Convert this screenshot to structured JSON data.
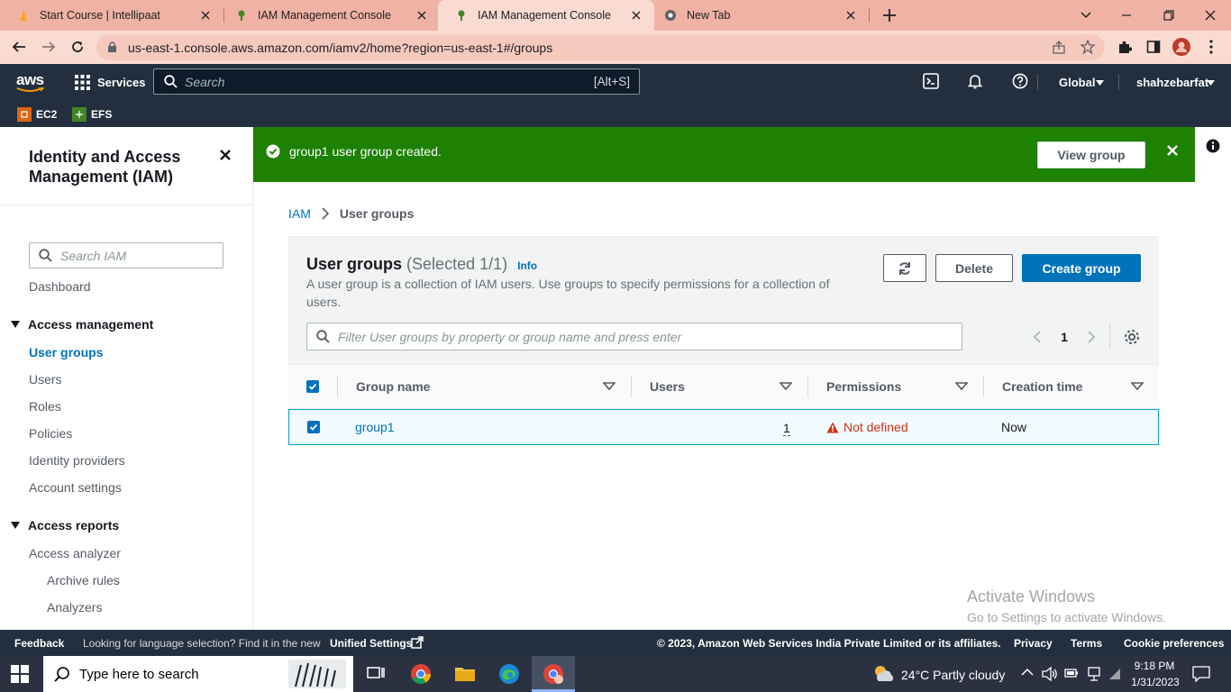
{
  "browser": {
    "tabs": [
      {
        "title": "Start Course | Intellipaat",
        "active": false
      },
      {
        "title": "IAM Management Console",
        "active": false
      },
      {
        "title": "IAM Management Console",
        "active": true
      },
      {
        "title": "New Tab",
        "active": false
      }
    ],
    "url": "us-east-1.console.aws.amazon.com/iamv2/home?region=us-east-1#/groups"
  },
  "aws_header": {
    "logo": "aws",
    "services": "Services",
    "search_placeholder": "Search",
    "search_shortcut": "[Alt+S]",
    "region": "Global",
    "account": "shahzebarfat",
    "favorites": [
      "EC2",
      "EFS"
    ]
  },
  "sidebar": {
    "title": "Identity and Access Management (IAM)",
    "search_placeholder": "Search IAM",
    "dashboard": "Dashboard",
    "section1": "Access management",
    "items1": [
      "User groups",
      "Users",
      "Roles",
      "Policies",
      "Identity providers",
      "Account settings"
    ],
    "active_item": "User groups",
    "section2": "Access reports",
    "items2": [
      "Access analyzer",
      "Archive rules",
      "Analyzers"
    ]
  },
  "flash": {
    "message": "group1 user group created.",
    "button": "View group",
    "color": "#1d8102"
  },
  "breadcrumb": {
    "root": "IAM",
    "current": "User groups"
  },
  "panel": {
    "title": "User groups",
    "count": "(Selected 1/1)",
    "info": "Info",
    "description": "A user group is a collection of IAM users. Use groups to specify permissions for a collection of users.",
    "delete_label": "Delete",
    "create_label": "Create group",
    "filter_placeholder": "Filter User groups by property or group name and press enter",
    "page": "1"
  },
  "table": {
    "columns": [
      "Group name",
      "Users",
      "Permissions",
      "Creation time"
    ],
    "rows": [
      {
        "name": "group1",
        "users": "1",
        "permissions": "Not defined",
        "created": "Now",
        "selected": true
      }
    ]
  },
  "watermark": {
    "line1": "Activate Windows",
    "line2": "Go to Settings to activate Windows."
  },
  "footer": {
    "feedback": "Feedback",
    "lang_text": "Looking for language selection? Find it in the new",
    "lang_link": "Unified Settings",
    "copyright": "© 2023, Amazon Web Services India Private Limited or its affiliates.",
    "links": [
      "Privacy",
      "Terms",
      "Cookie preferences"
    ]
  },
  "taskbar": {
    "search_placeholder": "Type here to search",
    "weather": "24°C  Partly cloudy",
    "time": "9:18 PM",
    "date": "1/31/2023"
  },
  "colors": {
    "aws_dark": "#232f3e",
    "link": "#0073bb",
    "primary": "#0073bb",
    "error": "#d13212"
  }
}
